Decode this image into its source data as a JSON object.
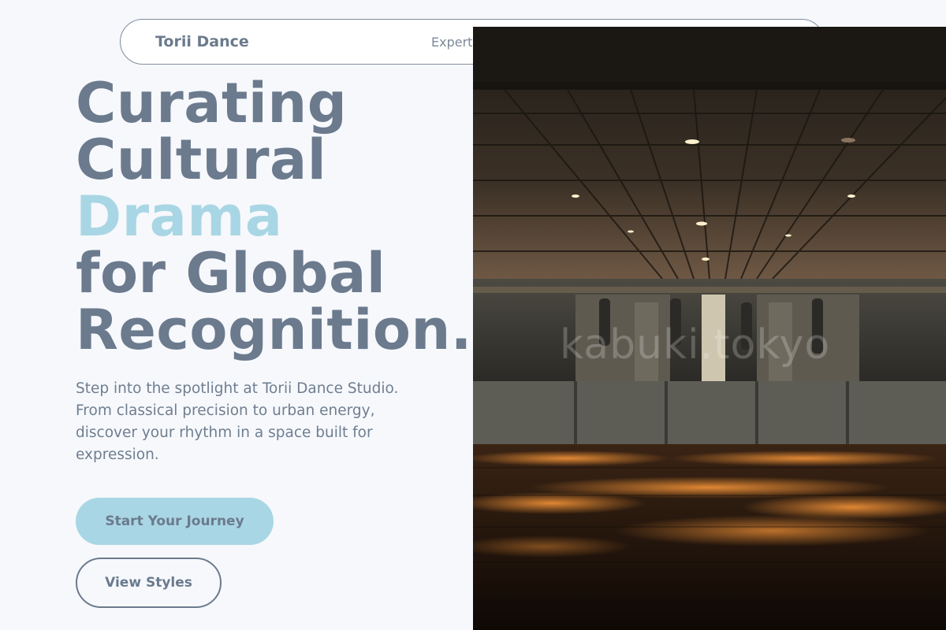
{
  "nav": {
    "brand": "Torii Dance",
    "links": [
      "Expert"
    ]
  },
  "hero": {
    "headline": {
      "line1": "Curating",
      "line2": "Cultural",
      "line3_accent": "Drama",
      "line4": "for Global",
      "line5": "Recognition."
    },
    "lead": "Step into the spotlight at Torii Dance Studio. From classical precision to urban energy, discover your rhythm in a space built for expression.",
    "primary_cta": "Start Your Journey",
    "secondary_cta": "View Styles"
  },
  "image": {
    "watermark": "kabuki.tokyo"
  },
  "colors": {
    "background": "#f6f8fc",
    "text": "#6b7a8d",
    "accent": "#a9d6e4"
  }
}
